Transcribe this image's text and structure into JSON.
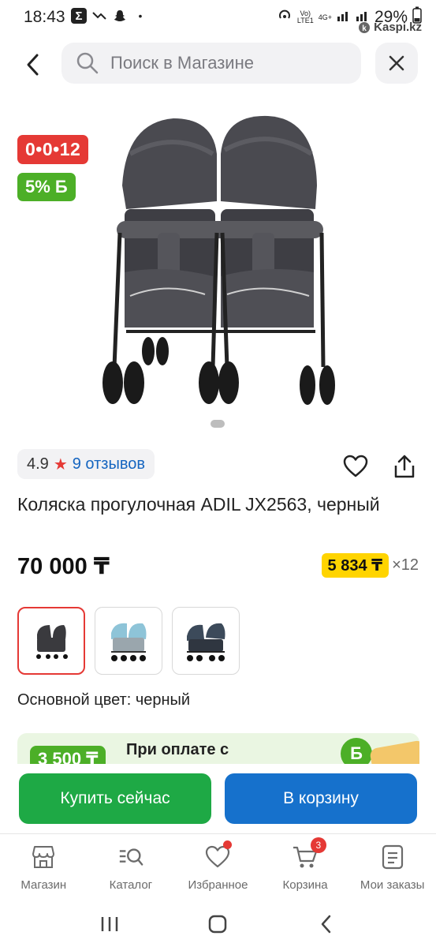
{
  "status_bar": {
    "time": "18:43",
    "battery": "29%",
    "network": "4G+",
    "carrier_tag": "LTE1",
    "watermark": "Kaspi.kz"
  },
  "header": {
    "search_placeholder": "Поиск в Магазине"
  },
  "product": {
    "timer_badge": "0•0•12",
    "bonus_badge": "5% Б",
    "rating": "4.9",
    "reviews": "9 отзывов",
    "title": "Коляска прогулочная ADIL JX2563, черный",
    "price": "70 000 ₸",
    "installment_amount": "5 834 ₸",
    "installment_times": "×12",
    "color_label": "Основной цвет: черный",
    "variants": [
      {
        "name": "black",
        "color": "#3a3a3e"
      },
      {
        "name": "light-blue",
        "color": "#8ec4d8"
      },
      {
        "name": "dark-blue",
        "color": "#3c4a5a"
      }
    ]
  },
  "promo": {
    "amount": "3 500 ₸",
    "text": "При оплате с"
  },
  "actions": {
    "buy_now": "Купить сейчас",
    "add_to_cart": "В корзину"
  },
  "bottom_nav": {
    "items": [
      {
        "label": "Магазин",
        "icon": "store-icon"
      },
      {
        "label": "Каталог",
        "icon": "catalog-search-icon"
      },
      {
        "label": "Избранное",
        "icon": "heart-icon"
      },
      {
        "label": "Корзина",
        "icon": "cart-icon",
        "badge": "3"
      },
      {
        "label": "Мои заказы",
        "icon": "orders-icon"
      }
    ]
  },
  "colors": {
    "accent_red": "#e53935",
    "accent_green": "#1ea945",
    "accent_blue": "#1671cc",
    "installment_yellow": "#ffd400"
  }
}
